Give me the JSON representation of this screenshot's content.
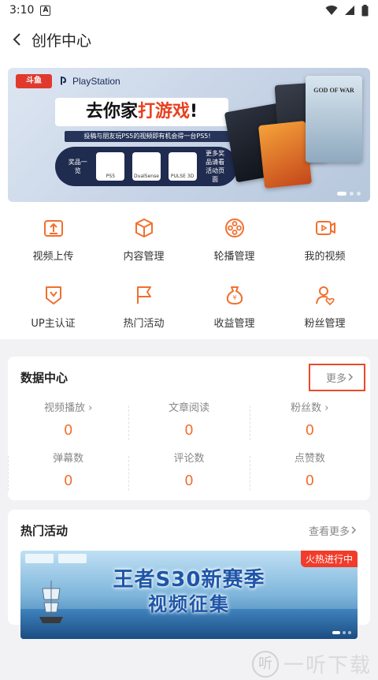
{
  "status_bar": {
    "time": "3:10",
    "notification": "A"
  },
  "app_bar": {
    "title": "创作中心"
  },
  "banner": {
    "brand_douyu": "斗鱼",
    "brand_ps": "PlayStation",
    "headline_a": "去你家",
    "headline_b": "打游戏",
    "headline_c": "!",
    "subline": "投稿与朋友玩PS5的视频即有机会得一台PS5!",
    "prize_left": "奖品一览",
    "prize_right": "更多奖品请看活动页面",
    "prizes": [
      "PS5",
      "DualSense",
      "PULSE 3D"
    ],
    "cover_text": "GOD OF WAR"
  },
  "grid": [
    {
      "label": "视频上传",
      "icon": "upload-icon"
    },
    {
      "label": "内容管理",
      "icon": "cube-icon"
    },
    {
      "label": "轮播管理",
      "icon": "film-reel-icon"
    },
    {
      "label": "我的视频",
      "icon": "video-icon"
    },
    {
      "label": "UP主认证",
      "icon": "badge-icon"
    },
    {
      "label": "热门活动",
      "icon": "flag-icon"
    },
    {
      "label": "收益管理",
      "icon": "money-bag-icon"
    },
    {
      "label": "粉丝管理",
      "icon": "fans-icon"
    }
  ],
  "data_center": {
    "title": "数据中心",
    "more": "更多",
    "stats": [
      {
        "label": "视频播放",
        "value": "0",
        "arrow": true
      },
      {
        "label": "文章阅读",
        "value": "0",
        "arrow": false
      },
      {
        "label": "粉丝数",
        "value": "0",
        "arrow": true
      },
      {
        "label": "弹幕数",
        "value": "0",
        "arrow": false
      },
      {
        "label": "评论数",
        "value": "0",
        "arrow": false
      },
      {
        "label": "点赞数",
        "value": "0",
        "arrow": false
      }
    ]
  },
  "hot_activity": {
    "title": "热门活动",
    "more": "查看更多",
    "banner_title": "王者S30新赛季",
    "banner_sub": "视频征集",
    "tag": "火热进行中"
  },
  "watermark": {
    "text": "一听下载",
    "logo": "听"
  },
  "colors": {
    "accent": "#f07030",
    "highlight_box": "#e84a2a",
    "hot_tag": "#f23b2a"
  }
}
